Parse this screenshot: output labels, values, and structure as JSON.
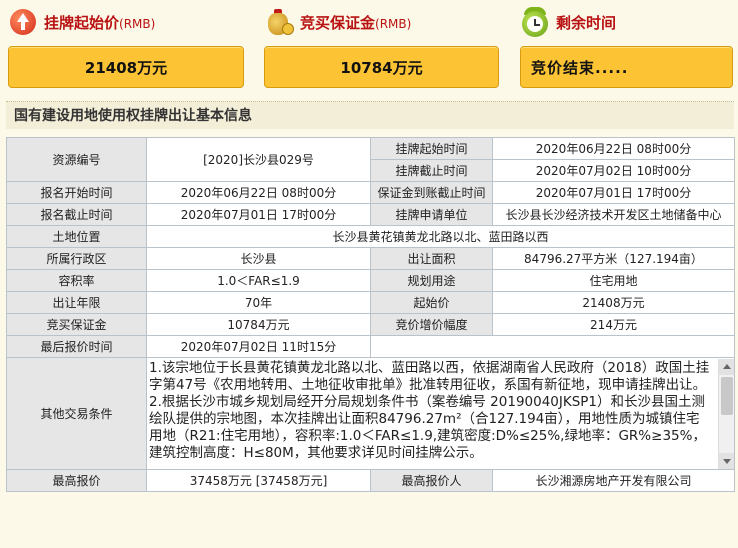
{
  "stats": [
    {
      "label": "挂牌起始价",
      "unit": "(RMB)",
      "value": "21408万元",
      "icon": "price-up-icon"
    },
    {
      "label": "竞买保证金",
      "unit": "(RMB)",
      "value": "10784万元",
      "icon": "money-bag-icon"
    },
    {
      "label": "剩余时间",
      "unit": "",
      "value": "竞价结束.....",
      "icon": "alarm-clock-icon"
    }
  ],
  "section_title": "国有建设用地使用权挂牌出让基本信息",
  "info": {
    "resource_no_label": "资源编号",
    "resource_no": "[2020]长沙县029号",
    "listing_start_label": "挂牌起始时间",
    "listing_start": "2020年06月22日 08时00分",
    "listing_end_label": "挂牌截止时间",
    "listing_end": "2020年07月02日 10时00分",
    "reg_start_label": "报名开始时间",
    "reg_start": "2020年06月22日 08时00分",
    "deposit_deadline_label": "保证金到账截止时间",
    "deposit_deadline": "2020年07月01日 17时00分",
    "reg_end_label": "报名截止时间",
    "reg_end": "2020年07月01日 17时00分",
    "applicant_label": "挂牌申请单位",
    "applicant": "长沙县长沙经济技术开发区土地储备中心",
    "location_label": "土地位置",
    "location": "长沙县黄花镇黄龙北路以北、蓝田路以西",
    "district_label": "所属行政区",
    "district": "长沙县",
    "area_label": "出让面积",
    "area": "84796.27平方米（127.194亩）",
    "far_label": "容积率",
    "far": "1.0＜FAR≤1.9",
    "use_label": "规划用途",
    "use": "住宅用地",
    "term_label": "出让年限",
    "term": "70年",
    "start_price_label": "起始价",
    "start_price": "21408万元",
    "deposit_label": "竞买保证金",
    "deposit": "10784万元",
    "increment_label": "竞价增价幅度",
    "increment": "214万元",
    "last_quote_time_label": "最后报价时间",
    "last_quote_time": "2020年07月02日 11时15分",
    "other_terms_label": "其他交易条件",
    "other_terms_p1": "1.该宗地位于长县黄花镇黄龙北路以北、蓝田路以西，依据湖南省人民政府（2018）政国土挂字第47号《农用地转用、土地征收审批单》批准转用征收，系国有新征地，现申请挂牌出让。",
    "other_terms_p2": "2.根据长沙市城乡规划局经开分局规划条件书（案卷编号 20190040JKSP1）和长沙县国土测绘队提供的宗地图，本次挂牌出让面积84796.27m²（合127.194亩），用地性质为城镇住宅用地（R21:住宅用地），容积率:1.0＜FAR≤1.9,建筑密度:D%≤25%,绿地率：GR%≥35%，建筑控制高度：H≤80M，其他要求详见时间挂牌公示。",
    "highest_price_label": "最高报价",
    "highest_price": "37458万元 [37458万元]",
    "highest_bidder_label": "最高报价人",
    "highest_bidder": "长沙湘源房地产开发有限公司"
  }
}
